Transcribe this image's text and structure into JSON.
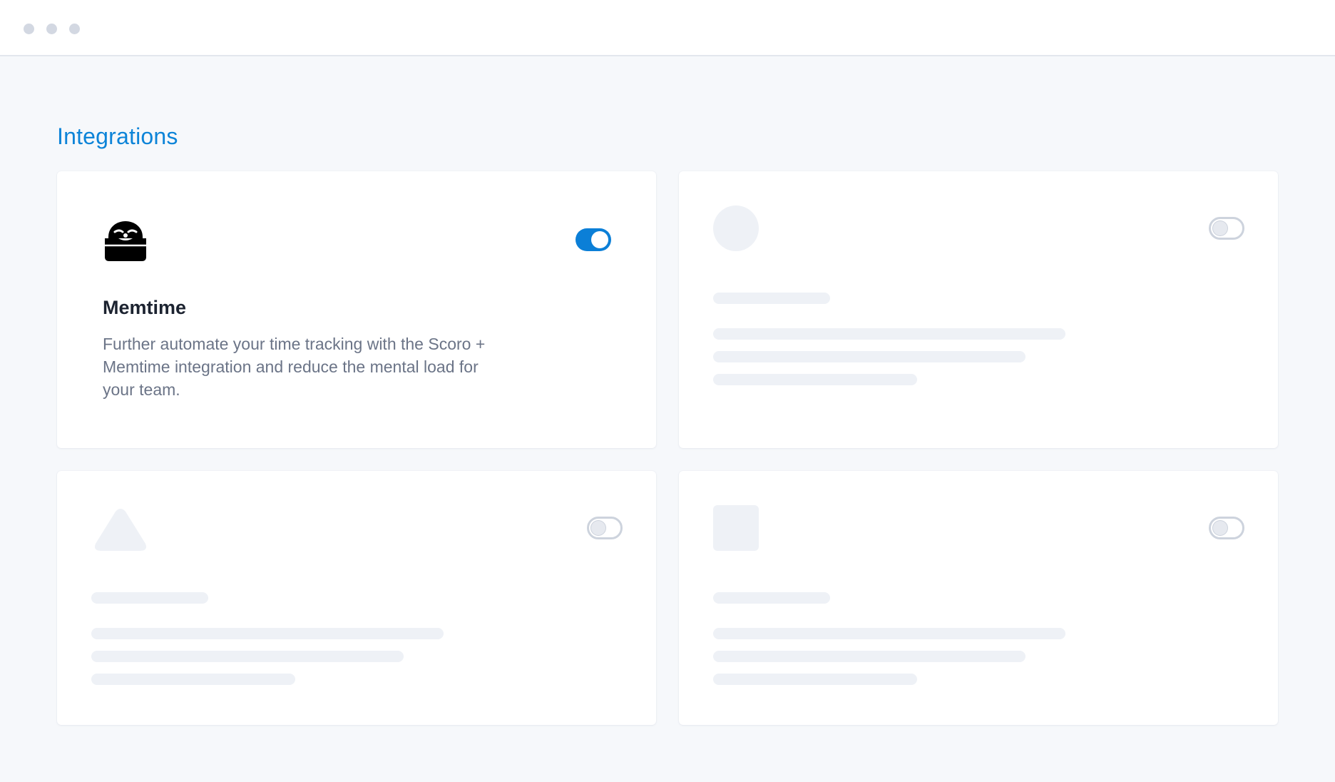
{
  "window": {
    "controls": [
      "dot",
      "dot",
      "dot"
    ]
  },
  "page": {
    "title": "Integrations"
  },
  "integrations": [
    {
      "name": "Memtime",
      "description": "Further automate  your time tracking with the Scoro +  Memtime integration and reduce the mental load for your team.",
      "icon": "memtime-logo-icon",
      "enabled": true
    },
    {
      "placeholder": true,
      "icon": "circle-placeholder",
      "enabled": false
    },
    {
      "placeholder": true,
      "icon": "triangle-placeholder",
      "enabled": false
    },
    {
      "placeholder": true,
      "icon": "square-placeholder",
      "enabled": false
    }
  ],
  "colors": {
    "accent": "#0b7fd7",
    "title": "#0d84d8",
    "background": "#f6f8fb",
    "skeleton": "#eef1f6"
  }
}
